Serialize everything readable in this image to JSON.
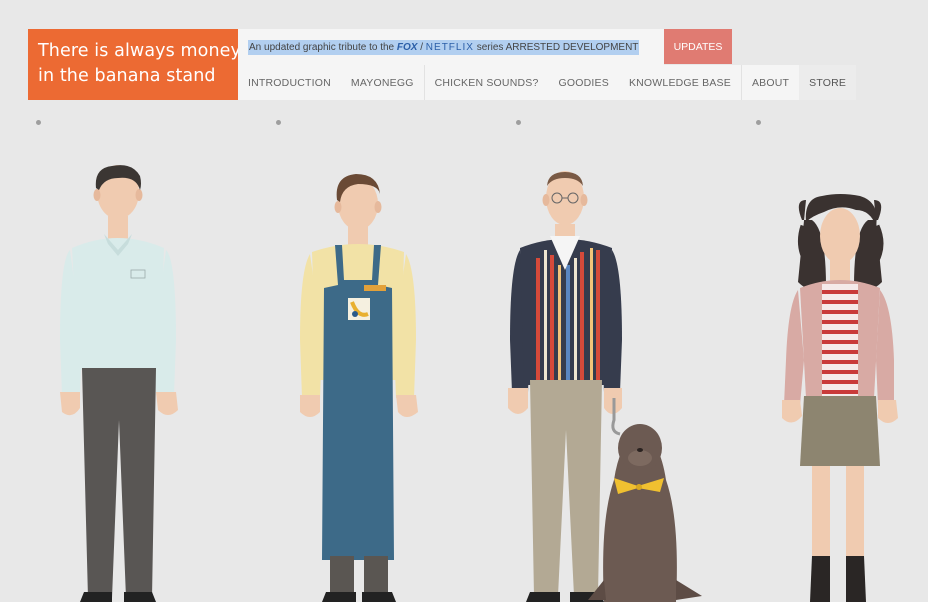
{
  "logo": {
    "line1": "There is always money",
    "line2": "in the banana stand"
  },
  "tagline": {
    "prefix": "An updated graphic tribute to the ",
    "fox": "FOX",
    "sep": " / ",
    "netflix": "NETFLIX",
    "suffix": " series ARRESTED DEVELOPMENT"
  },
  "updates_label": "UPDATES",
  "nav": {
    "introduction": "INTRODUCTION",
    "mayonegg": "MAYONEGG",
    "chicken": "CHICKEN SOUNDS?",
    "goodies": "GOODIES",
    "knowledge": "KNOWLEDGE BASE",
    "about": "ABOUT",
    "store": "STORE"
  },
  "colors": {
    "brand": "#ec6a33",
    "updates": "#e07b72",
    "highlight": "#b2cff0",
    "background": "#e8e8e8"
  },
  "characters": [
    "michael",
    "george-michael",
    "buster",
    "maeby"
  ],
  "extras": [
    "seal",
    "banana-badge"
  ]
}
